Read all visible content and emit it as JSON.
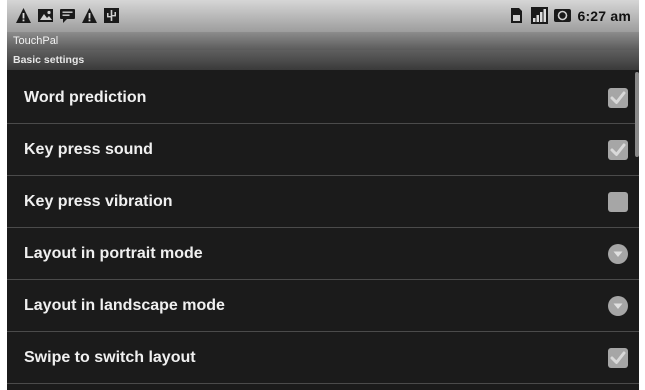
{
  "status_bar": {
    "left_icons": [
      "warning-icon",
      "image-icon",
      "message-icon",
      "warning-icon",
      "usb-icon"
    ],
    "right_icons": [
      "sim-icon",
      "signal-icon",
      "network-icon"
    ],
    "time": "6:27 am"
  },
  "app": {
    "title": "TouchPal"
  },
  "section": {
    "header": "Basic settings"
  },
  "settings": [
    {
      "label": "Word prediction",
      "control": "checkbox",
      "checked": true
    },
    {
      "label": "Key press sound",
      "control": "checkbox",
      "checked": true
    },
    {
      "label": "Key press vibration",
      "control": "checkbox",
      "checked": false
    },
    {
      "label": "Layout in portrait mode",
      "control": "dropdown"
    },
    {
      "label": "Layout in landscape mode",
      "control": "dropdown"
    },
    {
      "label": "Swipe to switch layout",
      "control": "checkbox",
      "checked": true
    }
  ],
  "colors": {
    "background": "#1b1b1b",
    "text": "#f0f0f0",
    "control": "#a6a6a6"
  }
}
